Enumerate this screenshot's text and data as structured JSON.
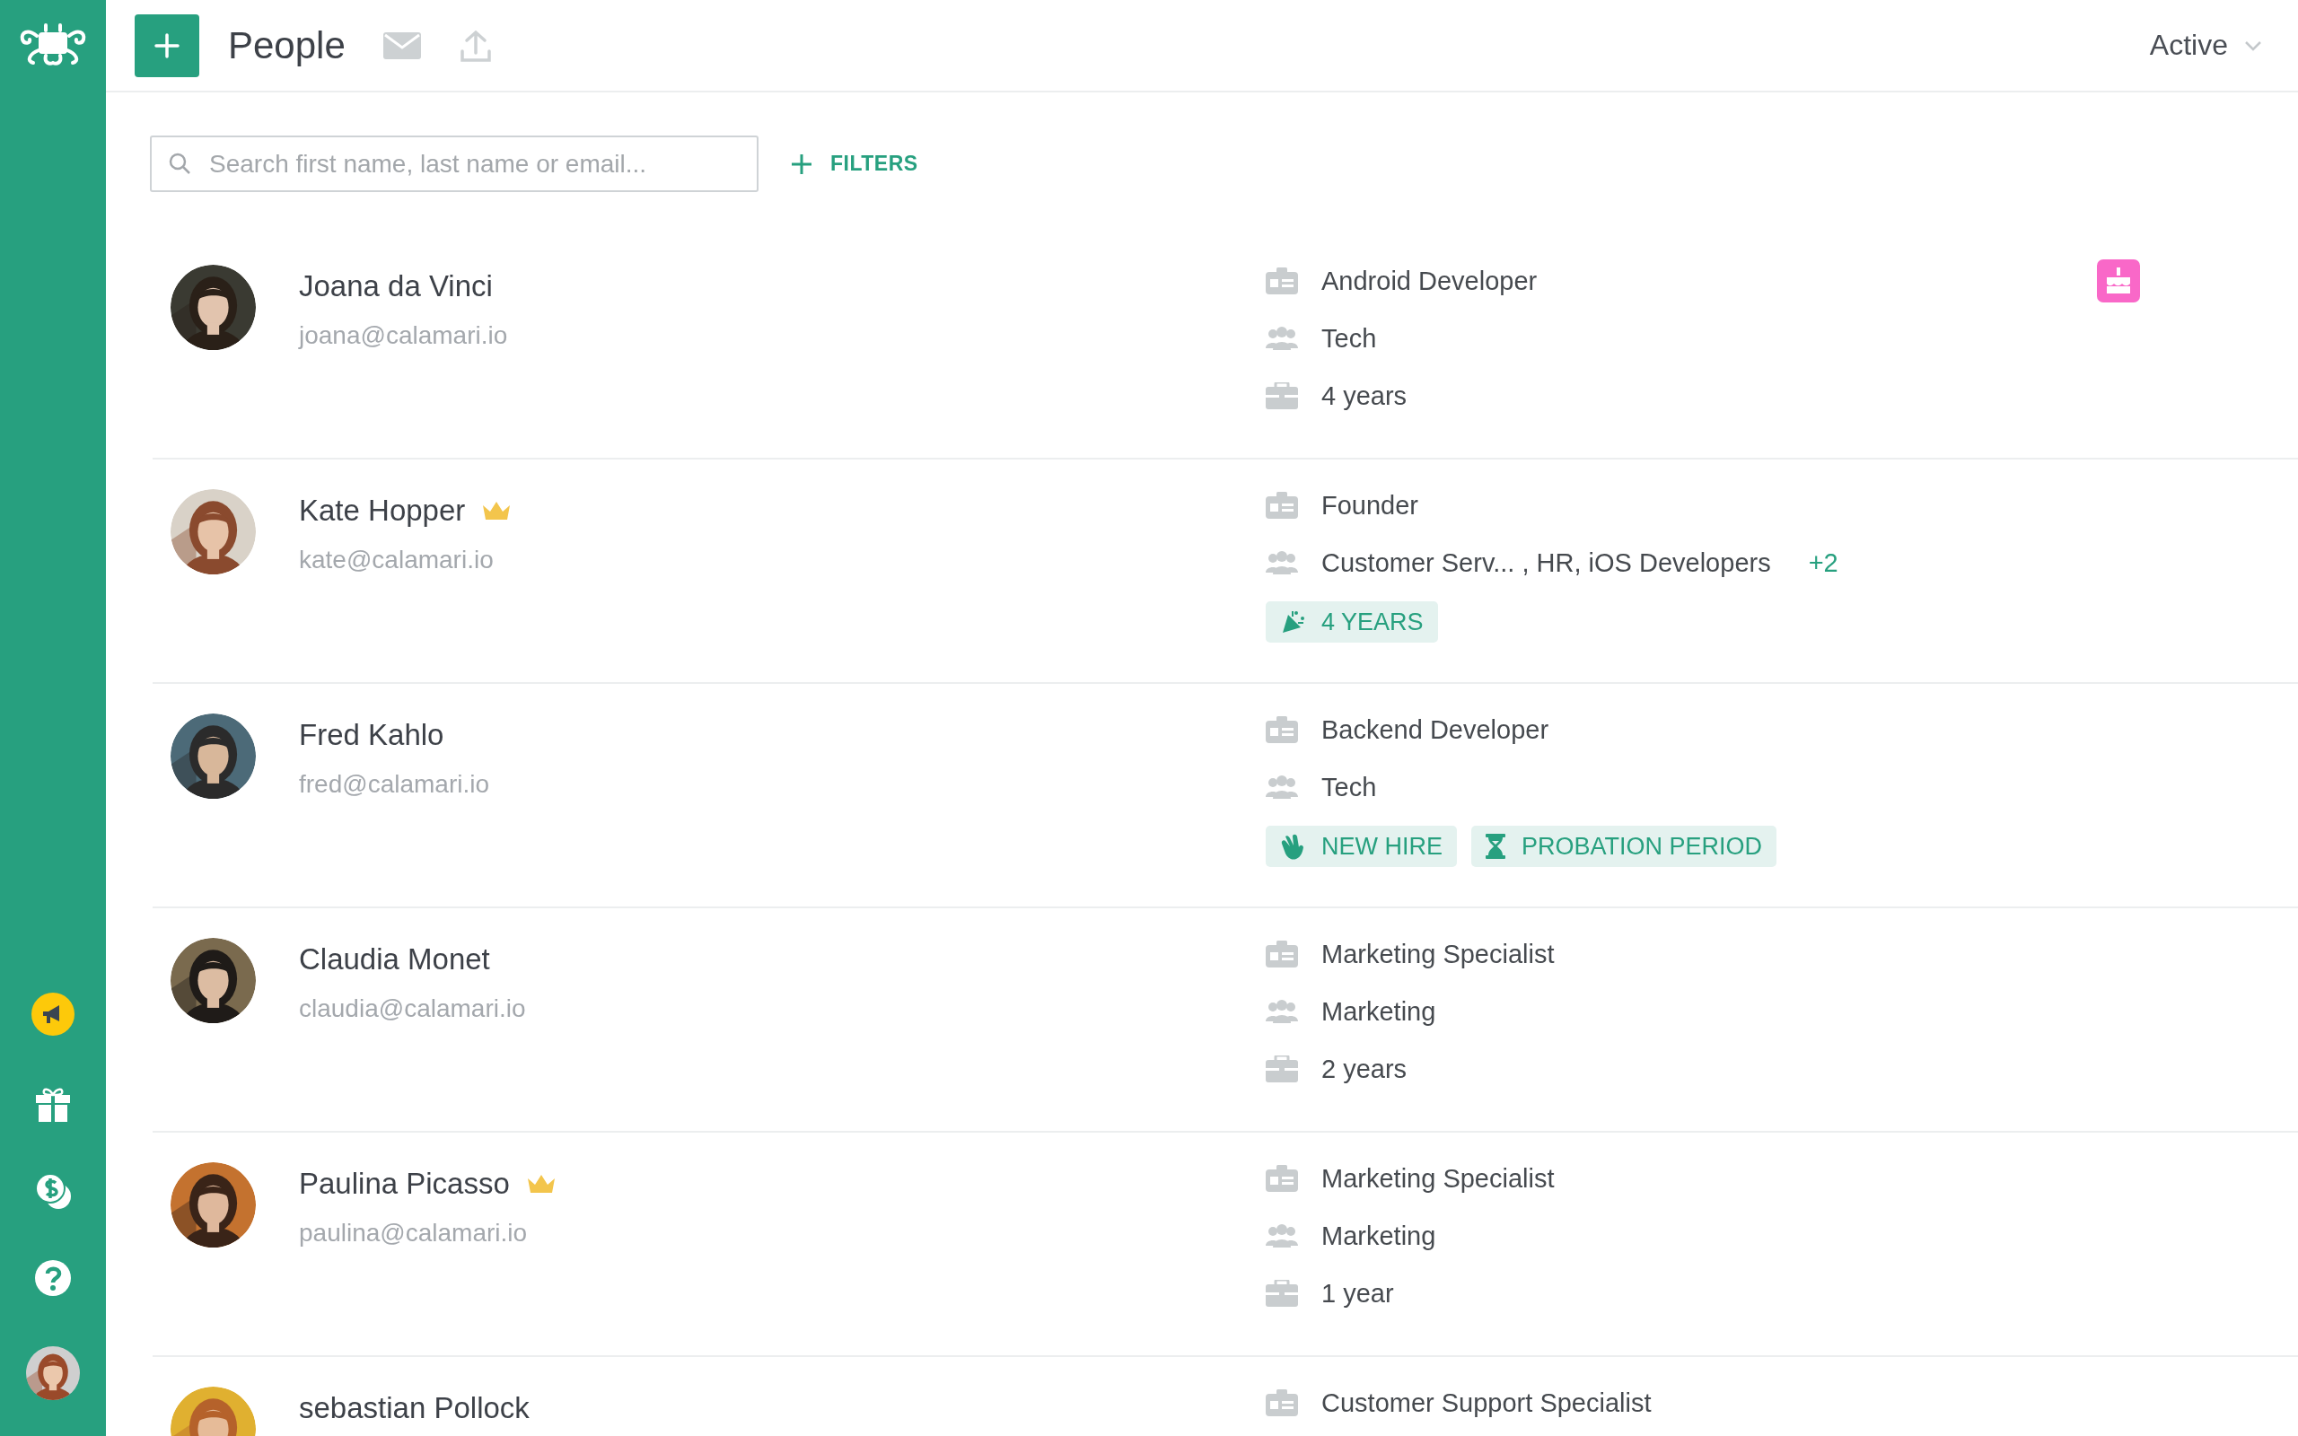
{
  "header": {
    "title": "People",
    "status_filter": "Active"
  },
  "search": {
    "placeholder": "Search first name, last name or email..."
  },
  "filters_button": "FILTERS",
  "people": [
    {
      "name": "Joana da Vinci",
      "email": "joana@calamari.io",
      "crown": false,
      "birthday": true,
      "job": "Android Developer",
      "teams": "Tech",
      "tenure": "4 years"
    },
    {
      "name": "Kate Hopper",
      "email": "kate@calamari.io",
      "crown": true,
      "birthday": false,
      "job": "Founder",
      "teams": "Customer Serv... , HR, iOS Developers",
      "teams_more": "+2",
      "tags": [
        {
          "kind": "anniversary",
          "label": "4 YEARS"
        }
      ]
    },
    {
      "name": "Fred Kahlo",
      "email": "fred@calamari.io",
      "crown": false,
      "birthday": false,
      "job": "Backend Developer",
      "teams": "Tech",
      "tags": [
        {
          "kind": "new_hire",
          "label": "NEW HIRE"
        },
        {
          "kind": "probation",
          "label": "PROBATION PERIOD"
        }
      ]
    },
    {
      "name": "Claudia Monet",
      "email": "claudia@calamari.io",
      "crown": false,
      "birthday": false,
      "job": "Marketing Specialist",
      "teams": "Marketing",
      "tenure": "2 years"
    },
    {
      "name": "Paulina Picasso",
      "email": "paulina@calamari.io",
      "crown": true,
      "birthday": false,
      "job": "Marketing Specialist",
      "teams": "Marketing",
      "tenure": "1 year"
    },
    {
      "name": "sebastian Pollock",
      "crown": false,
      "birthday": false,
      "job": "Customer Support Specialist"
    }
  ]
}
